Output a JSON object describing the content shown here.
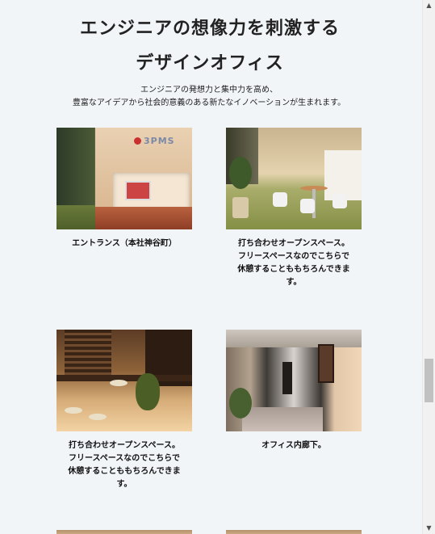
{
  "heading": {
    "line1": "エンジニアの想像力を刺激する",
    "line2": "デザインオフィス"
  },
  "lead": {
    "line1": "エンジニアの発想力と集中力を高め、",
    "line2": "豊富なアイデアから社会的意義のある新たなイノベーションが生まれます。"
  },
  "gallery": [
    {
      "caption": "エントランス（本社神谷町）"
    },
    {
      "caption_lines": [
        "打ち合わせオープンスペース。",
        "フリースペースなのでこちらで",
        "休憩することももちろんできま",
        "す。"
      ]
    },
    {
      "caption_lines": [
        "打ち合わせオープンスペース。",
        "フリースペースなのでこちらで",
        "休憩することももちろんできま",
        "す。"
      ]
    },
    {
      "caption": "オフィス内廊下。"
    }
  ],
  "photo1_logo": "3PMS",
  "scrollbar": {
    "up": "▲",
    "down": "▼"
  }
}
